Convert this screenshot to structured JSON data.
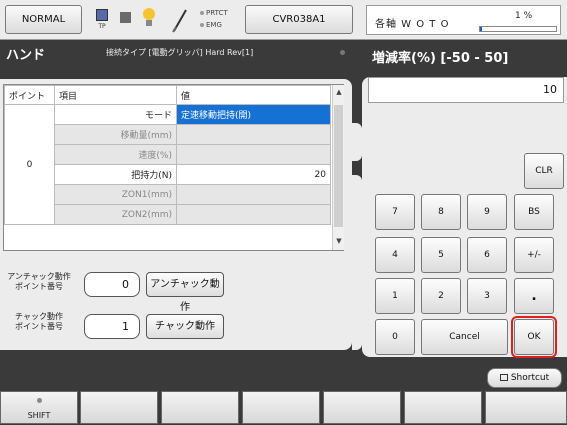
{
  "topbar": {
    "mode_label": "NORMAL",
    "tp_label": "TP",
    "protect_label": "PRTCT",
    "emg_label": "EMG",
    "program_label": "CVR038A1",
    "axis_label": "各軸 W O T O",
    "override_label": "1 %",
    "override_value": 0.01,
    "accent": "#1a5fd0"
  },
  "header": {
    "title": "ハンド",
    "connection_info": "接続タイプ [電動グリッパ]  Hard Rev[1]",
    "right_title": "増減率(%) [-50 - 50]"
  },
  "table": {
    "headers": [
      "ポイント",
      "項目",
      "値"
    ],
    "point_value": "0",
    "rows": [
      {
        "item": "モード",
        "value": "定速移動把持(開)"
      },
      {
        "item": "移動量(mm)",
        "value": ""
      },
      {
        "item": "速度(%)",
        "value": ""
      },
      {
        "item": "把持力(N)",
        "value": "20"
      },
      {
        "item": "ZON1(mm)",
        "value": ""
      },
      {
        "item": "ZON2(mm)",
        "value": ""
      }
    ],
    "selected_color": "#1671d4"
  },
  "controls": {
    "unchuck_label": "アンチャック動作\nポイント番号",
    "unchuck_value": "0",
    "unchuck_button": "アンチャック動作",
    "chuck_label": "チャック動作\nポイント番号",
    "chuck_value": "1",
    "chuck_button": "チャック動作"
  },
  "keypad": {
    "entry_value": "10",
    "clr": "CLR",
    "keys_row1": [
      "7",
      "8",
      "9",
      "BS"
    ],
    "keys_row2": [
      "4",
      "5",
      "6",
      "+/-"
    ],
    "keys_row3": [
      "1",
      "2",
      "3",
      "."
    ],
    "zero": "0",
    "cancel": "Cancel",
    "ok": "OK",
    "highlight_color": "#e02020"
  },
  "bottom": {
    "shortcut_label": "Shortcut",
    "shift_label": "SHIFT",
    "fkeys": [
      "",
      "",
      "",
      "",
      "",
      ""
    ]
  }
}
